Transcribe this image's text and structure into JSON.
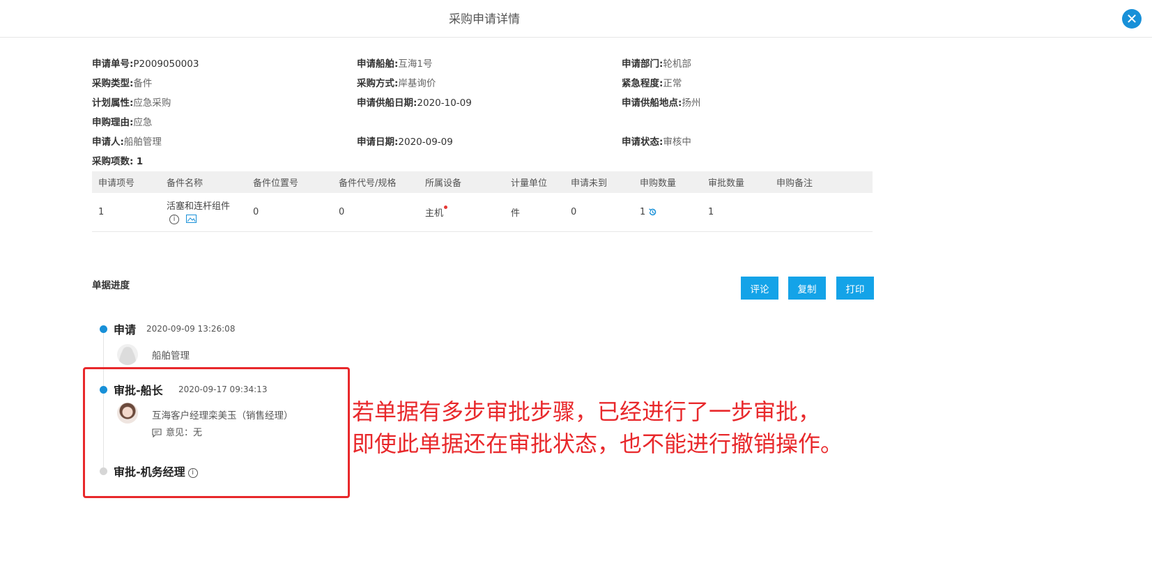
{
  "header": {
    "title": "采购申请详情",
    "close_icon": "close-icon"
  },
  "info": {
    "apply_no": {
      "label": "申请单号:",
      "value": "P2009050003"
    },
    "ship": {
      "label": "申请船舶:",
      "value": "互海1号"
    },
    "dept": {
      "label": "申请部门:",
      "value": "轮机部"
    },
    "purchase_type": {
      "label": "采购类型:",
      "value": "备件"
    },
    "purchase_method": {
      "label": "采购方式:",
      "value": "岸基询价"
    },
    "urgency": {
      "label": "紧急程度:",
      "value": "正常"
    },
    "plan_attr": {
      "label": "计划属性:",
      "value": "应急采购"
    },
    "supply_date": {
      "label": "申请供船日期:",
      "value": "2020-10-09"
    },
    "supply_place": {
      "label": "申请供船地点:",
      "value": "扬州"
    },
    "reason": {
      "label": "申购理由:",
      "value": "应急"
    },
    "applicant": {
      "label": "申请人:",
      "value": "船舶管理"
    },
    "apply_date": {
      "label": "申请日期:",
      "value": "2020-09-09"
    },
    "status": {
      "label": "申请状态:",
      "value": "审核中"
    },
    "item_count": {
      "label": "采购项数:",
      "value": "1"
    }
  },
  "table": {
    "headers": [
      "申请项号",
      "备件名称",
      "备件位置号",
      "备件代号/规格",
      "所属设备",
      "计量单位",
      "申请未到",
      "申购数量",
      "审批数量",
      "申购备注"
    ],
    "rows": [
      {
        "no": "1",
        "name": "活塞和连杆组件",
        "position": "0",
        "code": "0",
        "equipment": "主机",
        "unit": "件",
        "pending": "0",
        "qty": "1",
        "approved": "1",
        "remark": ""
      }
    ]
  },
  "progress": {
    "title": "单据进度",
    "buttons": {
      "comment": "评论",
      "copy": "复制",
      "print": "打印"
    },
    "steps": [
      {
        "name": "申请",
        "time": "2020-09-09 13:26:08",
        "person": "船舶管理"
      },
      {
        "name": "审批-船长",
        "time": "2020-09-17 09:34:13",
        "person": "互海客户经理栾美玉（销售经理）",
        "opinion": "意见：无"
      },
      {
        "name": "审批-机务经理"
      }
    ]
  },
  "annotation": {
    "line1": "若单据有多步审批步骤，已经进行了一步审批，",
    "line2": "即使此单据还在审批状态，也不能进行撤销操作。"
  },
  "colors": {
    "accent": "#14a3e8",
    "annotation": "#e8282b",
    "dot_active": "#1890d8",
    "dot_inactive": "#d6d6d6"
  }
}
